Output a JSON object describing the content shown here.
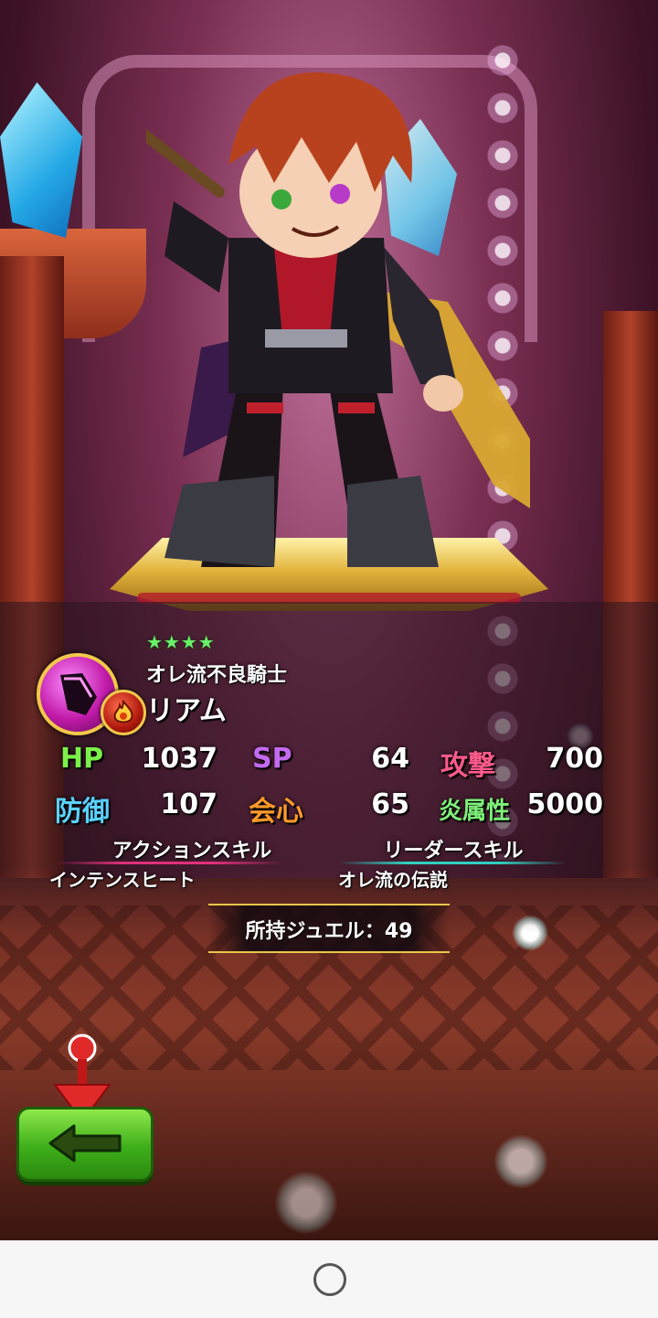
{
  "character": {
    "rarity_stars": "★★★★",
    "title": "オレ流不良騎士",
    "name": "リアム",
    "type_icon": "sword-type-icon",
    "element_icon": "fire-element-icon"
  },
  "stats": {
    "hp": {
      "label": "HP",
      "value": "1037"
    },
    "sp": {
      "label": "SP",
      "value": "64"
    },
    "attack": {
      "label": "攻撃",
      "value": "700"
    },
    "defense": {
      "label": "防御",
      "value": "107"
    },
    "critical": {
      "label": "会心",
      "value": "65"
    },
    "fire_attribute": {
      "label": "炎属性",
      "value": "5000"
    }
  },
  "skills": {
    "action": {
      "header": "アクションスキル",
      "name": "インテンスヒート"
    },
    "leader": {
      "header": "リーダースキル",
      "name": "オレ流の伝説"
    }
  },
  "jewels": {
    "text": "所持ジュエル：49"
  },
  "colors": {
    "hp_label": "#7cf04a",
    "sp_label": "#c36af0",
    "attack_label": "#ff5a8c",
    "defense_label": "#5ad2ff",
    "critical_label": "#ff9a2a",
    "fire_label": "#7ef07a",
    "action_skill_line": "#e0307a",
    "leader_skill_line": "#30d0c0",
    "back_button": "#4cbe22"
  },
  "controls": {
    "back_icon": "back-arrow-icon",
    "home_icon": "home-circle-icon"
  }
}
